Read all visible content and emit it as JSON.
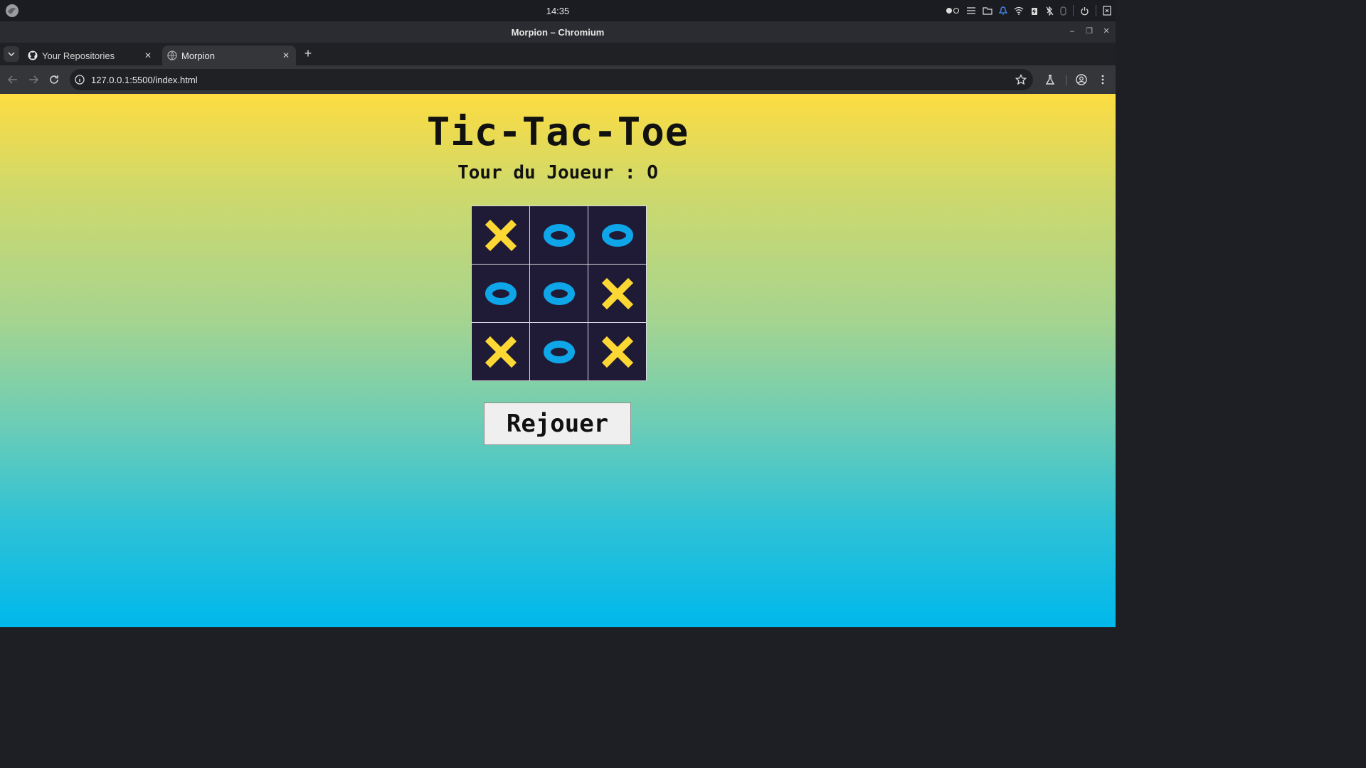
{
  "os": {
    "clock": "14:35"
  },
  "window": {
    "title": "Morpion – Chromium"
  },
  "tabs": [
    {
      "label": "Your Repositories",
      "icon": "github-icon",
      "active": false
    },
    {
      "label": "Morpion",
      "icon": "globe-icon",
      "active": true
    }
  ],
  "toolbar": {
    "url": "127.0.0.1:5500/index.html"
  },
  "game": {
    "title": "Tic-Tac-Toe",
    "turn_label": "Tour du Joueur : O",
    "board": [
      "X",
      "O",
      "O",
      "O",
      "O",
      "X",
      "X",
      "O",
      "X"
    ],
    "replay_label": "Rejouer",
    "colors": {
      "x": "#fdd835",
      "o": "#0ea5e9",
      "cell": "#1f1b36"
    }
  }
}
